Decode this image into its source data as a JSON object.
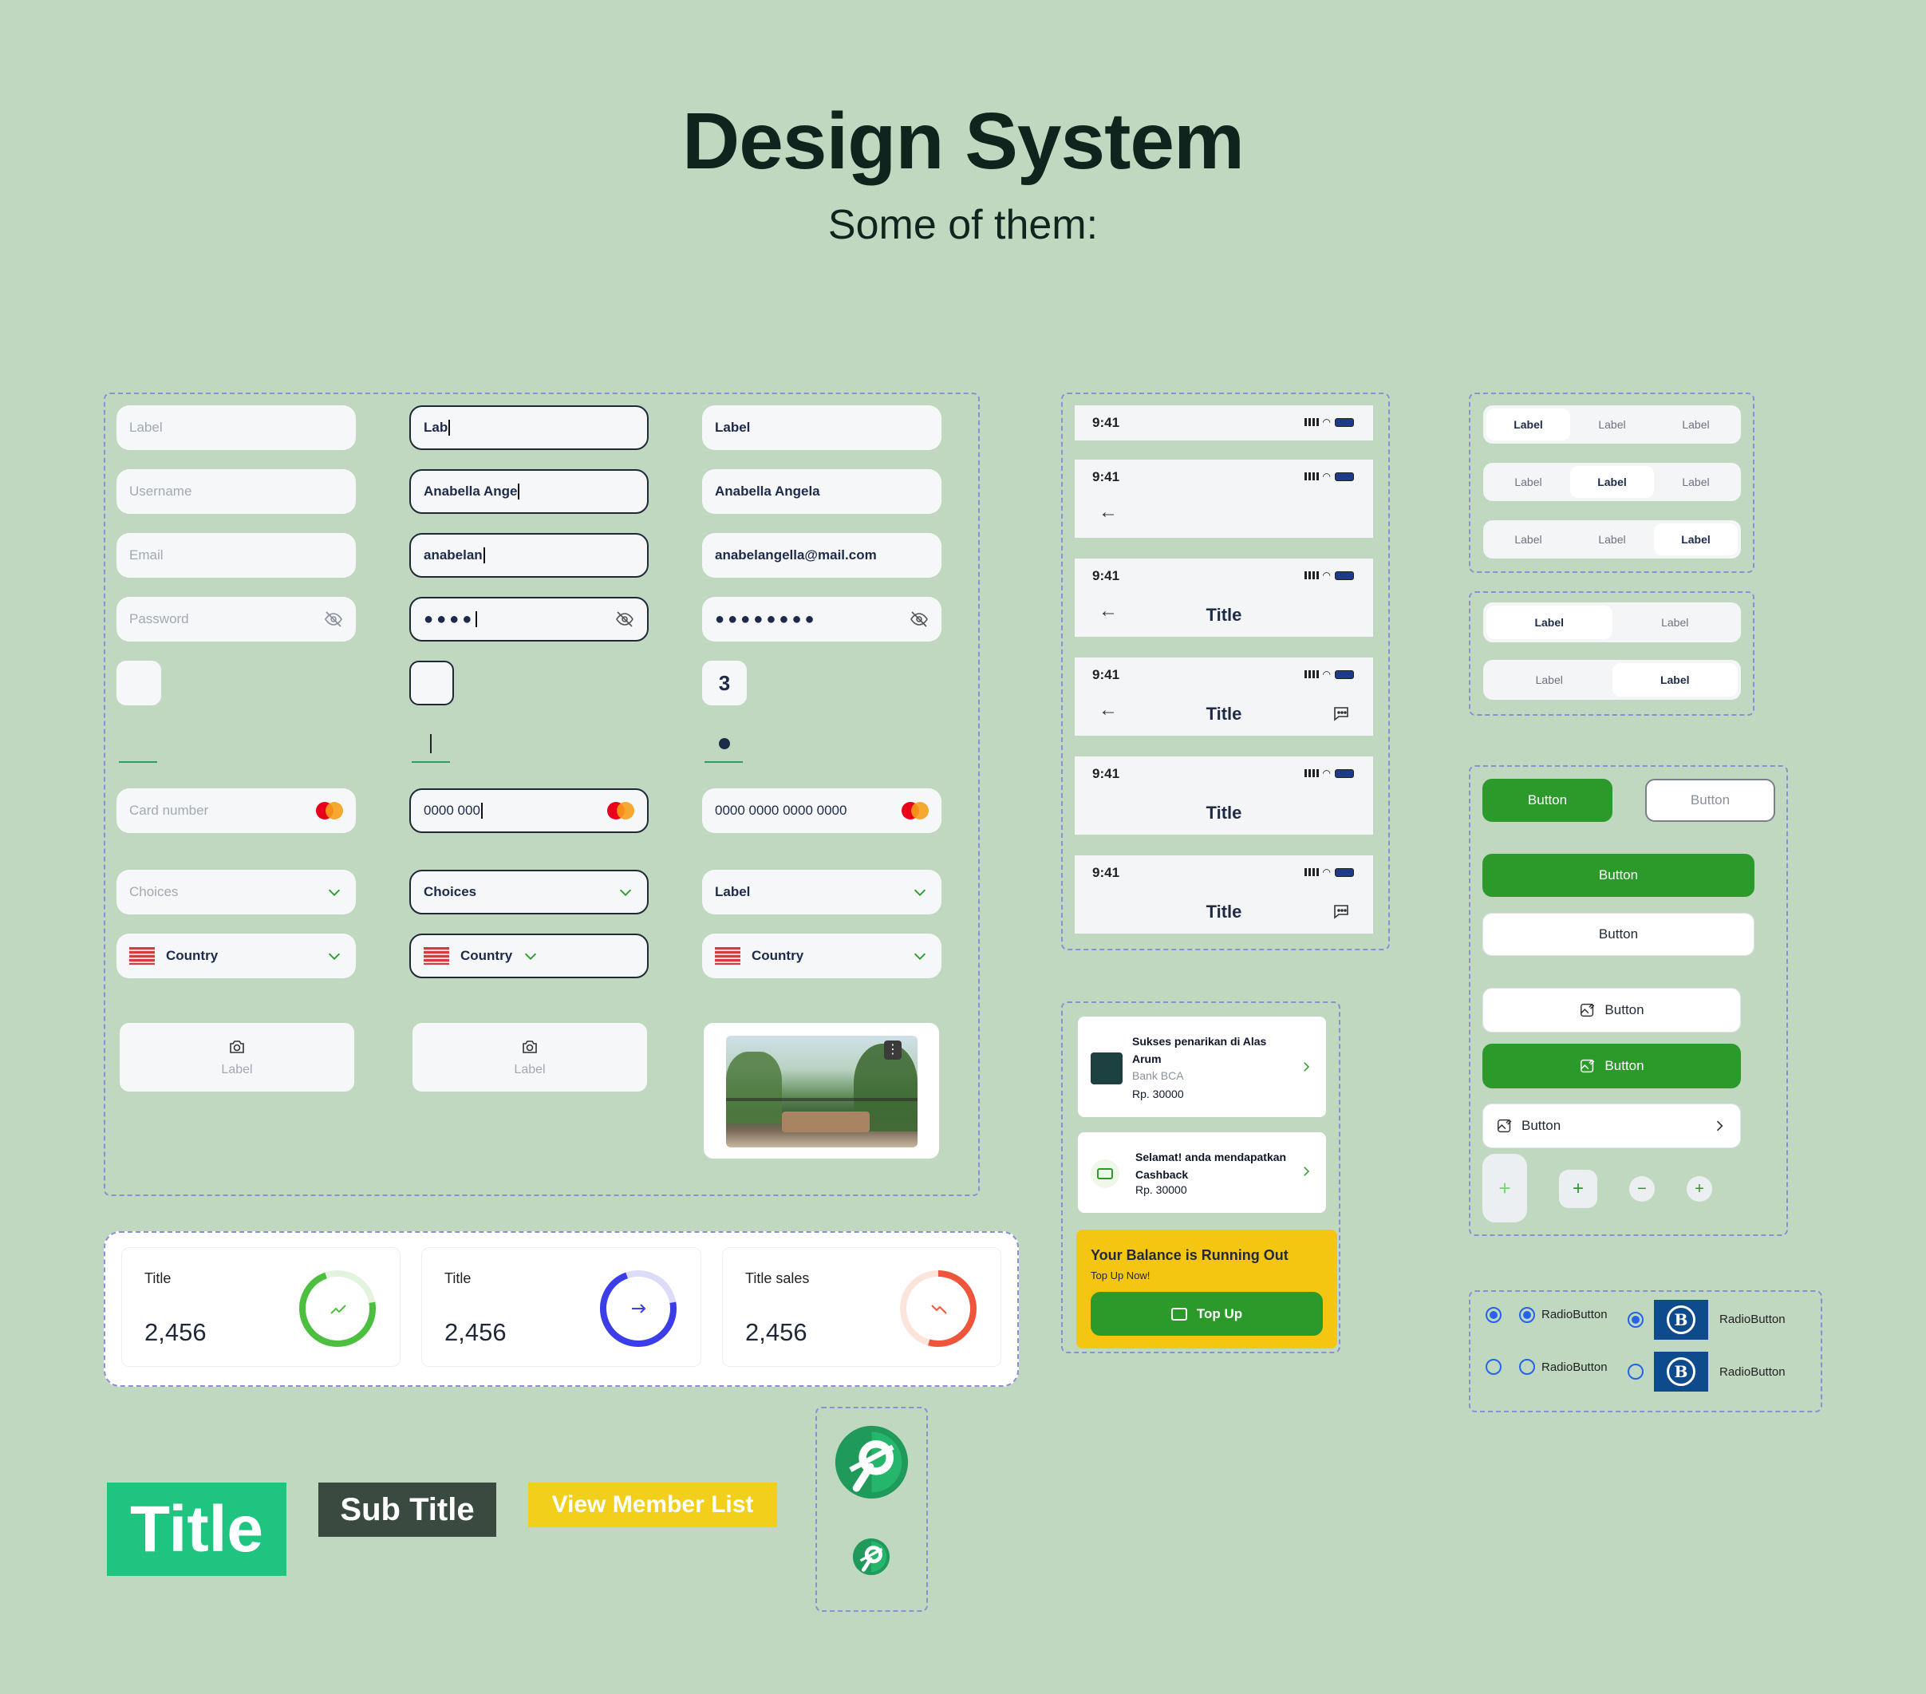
{
  "header": {
    "title": "Design System",
    "subtitle": "Some of them:"
  },
  "inputs": {
    "label_ph": "Label",
    "label_typing": "Lab",
    "label_filled": "Label",
    "username_ph": "Username",
    "username_typing": "Anabella Ange",
    "username_filled": "Anabella Angela",
    "email_ph": "Email",
    "email_typing": "anabelan",
    "email_filled": "anabelangella@mail.com",
    "password_ph": "Password",
    "password_typing": "●●●●",
    "password_filled": "●●●●●●●●",
    "otp_filled": "3",
    "card_ph": "Card number",
    "card_typing": "0000 000",
    "card_filled": "0000 0000 0000 0000",
    "choices_ph": "Choices",
    "choices_active": "Choices",
    "choices_filled": "Label",
    "country": "Country",
    "upload_label": "Label"
  },
  "status_bar": {
    "time": "9:41"
  },
  "appbar": {
    "title": "Title"
  },
  "segmented": {
    "label": "Label"
  },
  "buttons": {
    "label": "Button"
  },
  "stats": [
    {
      "title": "Title",
      "value": "2,456",
      "color": "#4cbf3f"
    },
    {
      "title": "Title",
      "value": "2,456",
      "color": "#3b3de8"
    },
    {
      "title": "Title sales",
      "value": "2,456",
      "color": "#f0553c"
    }
  ],
  "notifications": [
    {
      "title": "Sukses penarikan di Alas Arum",
      "sub": "Bank BCA",
      "amount": "Rp. 30000"
    },
    {
      "title": "Selamat! anda mendapatkan Cashback",
      "amount": "Rp. 30000"
    }
  ],
  "balance": {
    "title": "Your Balance is Running Out",
    "sub": "Top Up Now!",
    "button": "Top Up"
  },
  "radio": {
    "label": "RadioButton"
  },
  "typography": {
    "title": "Title",
    "subtitle": "Sub Title",
    "link": "View Member List"
  },
  "colors": {
    "accent": "#2c9a2a",
    "title_bg": "#1ec47f",
    "subtitle_bg": "#3b4a40",
    "link_bg": "#f2cf1a"
  }
}
